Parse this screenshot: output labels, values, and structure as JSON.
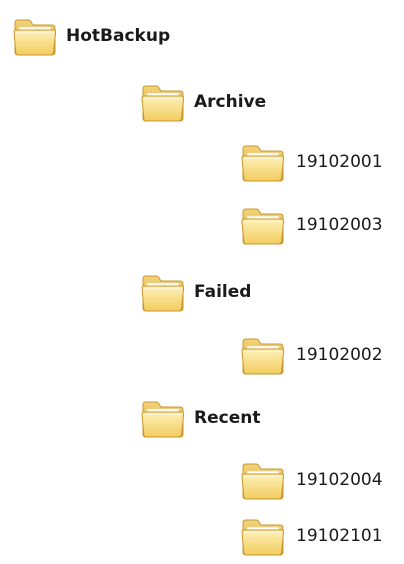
{
  "tree": {
    "root": {
      "label": "HotBackup",
      "icon": "folder-icon",
      "children": {
        "archive": {
          "label": "Archive",
          "icon": "folder-icon",
          "items": [
            "19102001",
            "19102003"
          ]
        },
        "failed": {
          "label": "Failed",
          "icon": "folder-icon",
          "items": [
            "19102002"
          ]
        },
        "recent": {
          "label": "Recent",
          "icon": "folder-icon",
          "items": [
            "19102004",
            "19102101"
          ]
        }
      }
    }
  },
  "colors": {
    "folder_fill_light": "#fbe59a",
    "folder_fill_dark": "#e9bf4e",
    "folder_stroke": "#c9952a"
  }
}
